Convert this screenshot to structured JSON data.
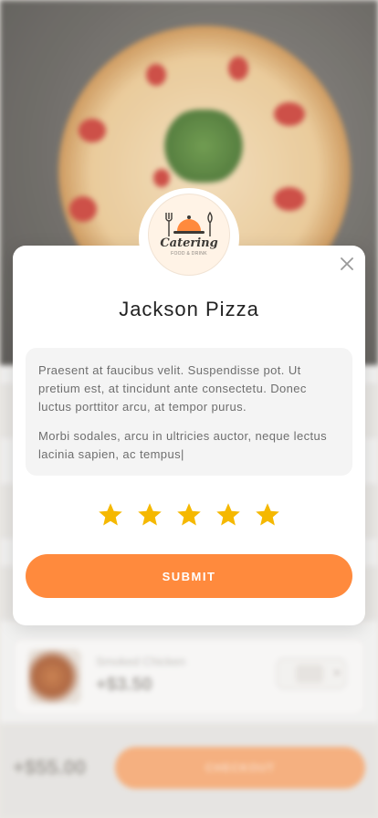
{
  "modal": {
    "brand": {
      "name": "Catering",
      "tagline": "FOOD & DRINK"
    },
    "title": "Jackson Pizza",
    "review_paragraphs": [
      "Praesent at faucibus velit. Suspendisse pot. Ut pretium est, at tincidunt ante consectetu. Donec luctus porttitor arcu, at tempor purus.",
      "Morbi sodales, arcu in ultricies auctor, neque lectus lacinia sapien, ac tempus|"
    ],
    "rating": 5,
    "rating_max": 5,
    "submit_label": "SUBMIT",
    "colors": {
      "accent": "#ff8a3d",
      "star": "#f5b800"
    }
  },
  "background": {
    "cart_item": {
      "name": "Smoked Chicken",
      "price": "+$3.50"
    },
    "footer": {
      "total": "+$55.00",
      "cta_label": "CHECKOUT"
    }
  }
}
